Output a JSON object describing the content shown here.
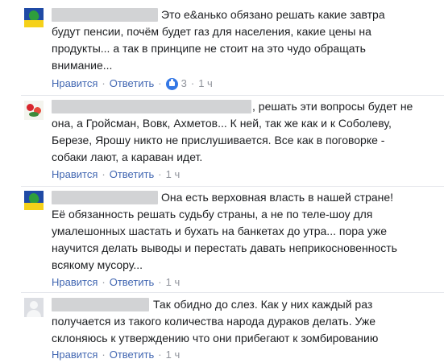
{
  "comments": [
    {
      "avatar": "flag-avatar",
      "lines": [
        "Это е&анько обязано решать какие завтра",
        "будут пенсии, почём будет газ для населения, какие цены на",
        "продукты... а так в принципе не стоит на это чудо обращать",
        "внимание..."
      ],
      "like_label": "Нравится",
      "reply_label": "Ответить",
      "reactions": "3",
      "time": "1 ч"
    },
    {
      "avatar": "flowers-avatar",
      "lines": [
        ", решать эти вопросы будет не",
        "она, а Гройсман, Вовк, Ахметов... К ней, так же как и к Соболеву,",
        "Березе, Ярошу никто не прислушивается. Все как в поговорке -",
        "собаки лают, а караван идет."
      ],
      "like_label": "Нравится",
      "reply_label": "Ответить",
      "time": "1 ч"
    },
    {
      "avatar": "flag-avatar",
      "lines": [
        "Она есть верховная власть в нашей стране!",
        "Её обязанность решать судьбу страны, а не по теле-шоу для",
        "умалешонных шастать и бухать на банкетах до утра... пора уже",
        "научится делать выводы и перестать давать неприкосновенность",
        "всякому мусору..."
      ],
      "like_label": "Нравится",
      "reply_label": "Ответить",
      "time": "1 ч"
    },
    {
      "avatar": "default-avatar",
      "lines": [
        "Так обидно до слез. Как у них каждый раз",
        "получается из такого количества народа дураков делать. Уже",
        "склоняюсь к утверждению что они прибегают к зомбированию"
      ],
      "like_label": "Нравится",
      "reply_label": "Ответить",
      "time": "1 ч"
    }
  ]
}
